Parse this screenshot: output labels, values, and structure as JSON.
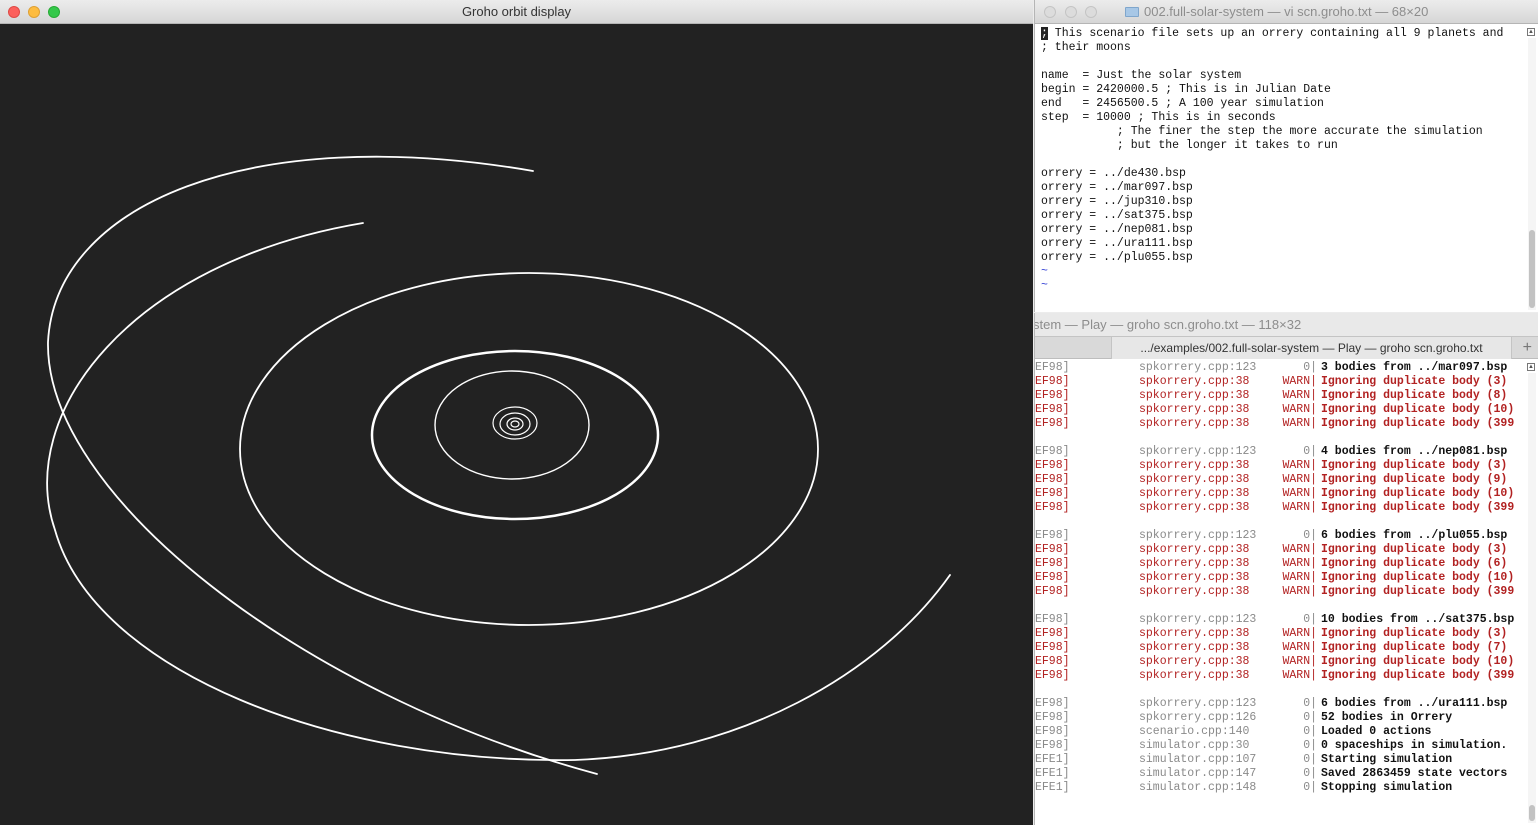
{
  "orbit_window": {
    "title": "Groho orbit display",
    "background": "#222222",
    "orbit_color": "#ffffff"
  },
  "vi_window": {
    "title": "002.full-solar-system — vi scn.groho.txt — 68×20",
    "lines": [
      "; This scenario file sets up an orrery containing all 9 planets and",
      "; their moons",
      "",
      "name  = Just the solar system",
      "begin = 2420000.5 ; This is in Julian Date",
      "end   = 2456500.5 ; A 100 year simulation",
      "step  = 10000 ; This is in seconds",
      "           ; The finer the step the more accurate the simulation",
      "           ; but the longer it takes to run",
      "",
      "orrery = ../de430.bsp",
      "orrery = ../mar097.bsp",
      "orrery = ../jup310.bsp",
      "orrery = ../sat375.bsp",
      "orrery = ../nep081.bsp",
      "orrery = ../ura111.bsp",
      "orrery = ../plu055.bsp"
    ],
    "tildes": [
      "~",
      "~"
    ]
  },
  "log_window": {
    "title": "stem — Play — groho scn.groho.txt — 118×32",
    "tab_label": ".../examples/002.full-solar-system — Play — groho scn.groho.txt",
    "add_tab": "+",
    "lines": [
      {
        "tag": "EF98]",
        "src": "spkorrery.cpp:123",
        "lvl": "0|",
        "msg": "3 bodies from ../mar097.bsp",
        "warn": false
      },
      {
        "tag": "EF98]",
        "src": "spkorrery.cpp:38",
        "lvl": "WARN|",
        "msg": "Ignoring duplicate body (3)",
        "warn": true
      },
      {
        "tag": "EF98]",
        "src": "spkorrery.cpp:38",
        "lvl": "WARN|",
        "msg": "Ignoring duplicate body (8)",
        "warn": true
      },
      {
        "tag": "EF98]",
        "src": "spkorrery.cpp:38",
        "lvl": "WARN|",
        "msg": "Ignoring duplicate body (10)",
        "warn": true
      },
      {
        "tag": "EF98]",
        "src": "spkorrery.cpp:38",
        "lvl": "WARN|",
        "msg": "Ignoring duplicate body (399",
        "warn": true
      },
      {
        "tag": "",
        "src": "",
        "lvl": "",
        "msg": "",
        "warn": false
      },
      {
        "tag": "EF98]",
        "src": "spkorrery.cpp:123",
        "lvl": "0|",
        "msg": "4 bodies from ../nep081.bsp",
        "warn": false
      },
      {
        "tag": "EF98]",
        "src": "spkorrery.cpp:38",
        "lvl": "WARN|",
        "msg": "Ignoring duplicate body (3)",
        "warn": true
      },
      {
        "tag": "EF98]",
        "src": "spkorrery.cpp:38",
        "lvl": "WARN|",
        "msg": "Ignoring duplicate body (9)",
        "warn": true
      },
      {
        "tag": "EF98]",
        "src": "spkorrery.cpp:38",
        "lvl": "WARN|",
        "msg": "Ignoring duplicate body (10)",
        "warn": true
      },
      {
        "tag": "EF98]",
        "src": "spkorrery.cpp:38",
        "lvl": "WARN|",
        "msg": "Ignoring duplicate body (399",
        "warn": true
      },
      {
        "tag": "",
        "src": "",
        "lvl": "",
        "msg": "",
        "warn": false
      },
      {
        "tag": "EF98]",
        "src": "spkorrery.cpp:123",
        "lvl": "0|",
        "msg": "6 bodies from ../plu055.bsp",
        "warn": false
      },
      {
        "tag": "EF98]",
        "src": "spkorrery.cpp:38",
        "lvl": "WARN|",
        "msg": "Ignoring duplicate body (3)",
        "warn": true
      },
      {
        "tag": "EF98]",
        "src": "spkorrery.cpp:38",
        "lvl": "WARN|",
        "msg": "Ignoring duplicate body (6)",
        "warn": true
      },
      {
        "tag": "EF98]",
        "src": "spkorrery.cpp:38",
        "lvl": "WARN|",
        "msg": "Ignoring duplicate body (10)",
        "warn": true
      },
      {
        "tag": "EF98]",
        "src": "spkorrery.cpp:38",
        "lvl": "WARN|",
        "msg": "Ignoring duplicate body (399",
        "warn": true
      },
      {
        "tag": "",
        "src": "",
        "lvl": "",
        "msg": "",
        "warn": false
      },
      {
        "tag": "EF98]",
        "src": "spkorrery.cpp:123",
        "lvl": "0|",
        "msg": "10 bodies from ../sat375.bsp",
        "warn": false
      },
      {
        "tag": "EF98]",
        "src": "spkorrery.cpp:38",
        "lvl": "WARN|",
        "msg": "Ignoring duplicate body (3)",
        "warn": true
      },
      {
        "tag": "EF98]",
        "src": "spkorrery.cpp:38",
        "lvl": "WARN|",
        "msg": "Ignoring duplicate body (7)",
        "warn": true
      },
      {
        "tag": "EF98]",
        "src": "spkorrery.cpp:38",
        "lvl": "WARN|",
        "msg": "Ignoring duplicate body (10)",
        "warn": true
      },
      {
        "tag": "EF98]",
        "src": "spkorrery.cpp:38",
        "lvl": "WARN|",
        "msg": "Ignoring duplicate body (399",
        "warn": true
      },
      {
        "tag": "",
        "src": "",
        "lvl": "",
        "msg": "",
        "warn": false
      },
      {
        "tag": "EF98]",
        "src": "spkorrery.cpp:123",
        "lvl": "0|",
        "msg": "6 bodies from ../ura111.bsp",
        "warn": false
      },
      {
        "tag": "EF98]",
        "src": "spkorrery.cpp:126",
        "lvl": "0|",
        "msg": "52 bodies in Orrery",
        "warn": false
      },
      {
        "tag": "EF98]",
        "src": "scenario.cpp:140",
        "lvl": "0|",
        "msg": "Loaded 0 actions",
        "warn": false
      },
      {
        "tag": "EF98]",
        "src": "simulator.cpp:30",
        "lvl": "0|",
        "msg": "0 spaceships in simulation.",
        "warn": false
      },
      {
        "tag": "EFE1]",
        "src": "simulator.cpp:107",
        "lvl": "0|",
        "msg": "Starting simulation",
        "warn": false
      },
      {
        "tag": "EFE1]",
        "src": "simulator.cpp:147",
        "lvl": "0|",
        "msg": "Saved 2863459 state vectors",
        "warn": false
      },
      {
        "tag": "EFE1]",
        "src": "simulator.cpp:148",
        "lvl": "0|",
        "msg": "Stopping simulation",
        "warn": false
      }
    ]
  },
  "colors": {
    "warn": "#b22222",
    "vi_tilde": "#3a47d6"
  }
}
